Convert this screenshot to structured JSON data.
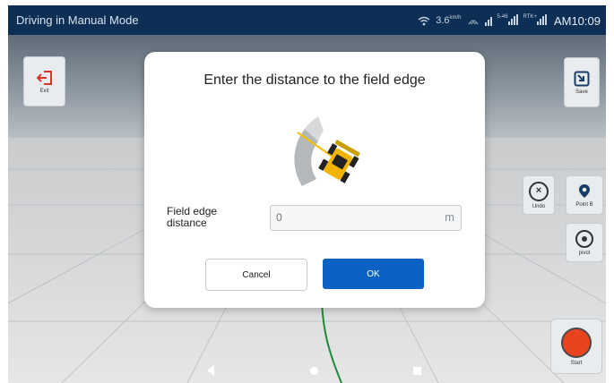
{
  "status_bar": {
    "title": "Driving in Manual Mode",
    "speed": "3.6",
    "speed_unit": "km/h",
    "signal_small_label": "5-46",
    "rtk_label": "RTK+",
    "time": "AM10:09"
  },
  "toolbar": {
    "exit_label": "Exit",
    "save_label": "Save",
    "undo_label": "Undo",
    "point_b_label": "Point B",
    "pivot_label": "pivot",
    "start_label": "Start"
  },
  "dialog": {
    "title": "Enter the distance to the field edge",
    "field_label": "Field edge distance",
    "field_placeholder": "0",
    "field_unit": "m",
    "cancel_label": "Cancel",
    "ok_label": "OK"
  },
  "colors": {
    "status_bar": "#0d2e55",
    "primary_button": "#0a63c3",
    "start_button": "#e8441f"
  },
  "icons": [
    "wifi-icon",
    "satellite-icon",
    "signal-icon",
    "exit-icon",
    "save-icon",
    "undo-icon",
    "location-pin-icon",
    "target-icon",
    "record-icon",
    "back-icon",
    "home-icon",
    "recent-apps-icon"
  ]
}
